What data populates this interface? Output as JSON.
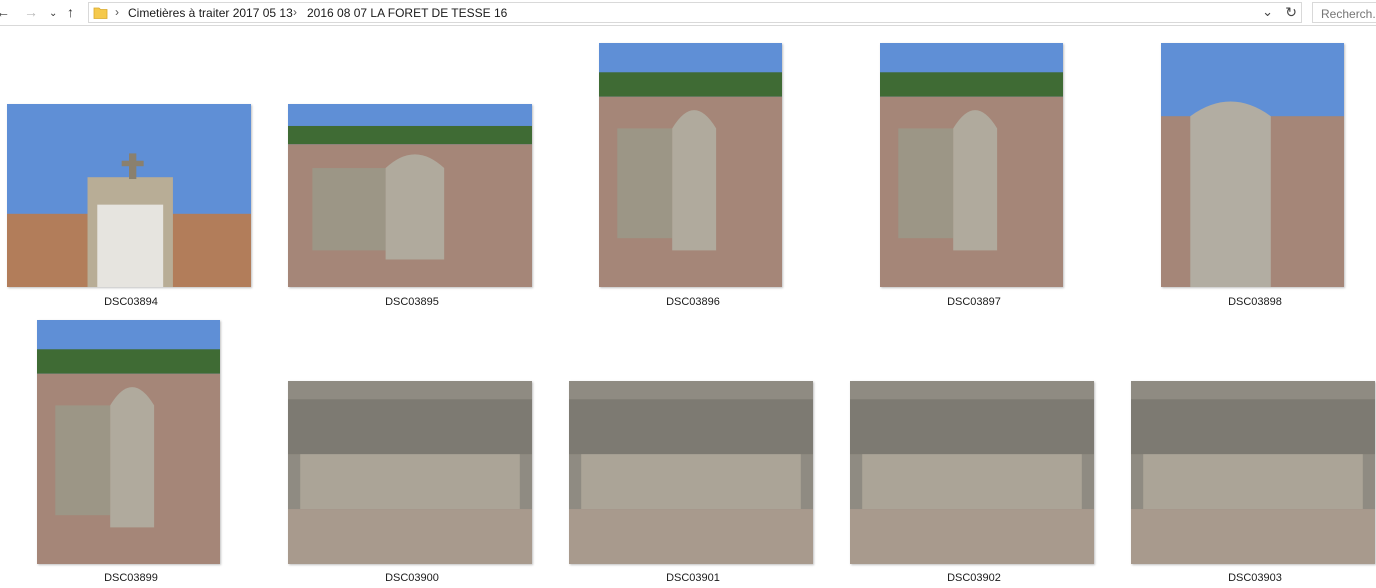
{
  "address": {
    "breadcrumbs": [
      "Cimetières à traiter 2017 05 13",
      "2016 08 07 LA FORET DE TESSE 16"
    ],
    "search_placeholder": "Recherch..."
  },
  "files": [
    {
      "name": "DSC03894",
      "kind": "gate"
    },
    {
      "name": "DSC03895",
      "kind": "graves-wide"
    },
    {
      "name": "DSC03896",
      "kind": "graves-tall"
    },
    {
      "name": "DSC03897",
      "kind": "graves-tall"
    },
    {
      "name": "DSC03898",
      "kind": "headstone"
    },
    {
      "name": "DSC03899",
      "kind": "graves-tall"
    },
    {
      "name": "DSC03900",
      "kind": "slab"
    },
    {
      "name": "DSC03901",
      "kind": "slab"
    },
    {
      "name": "DSC03902",
      "kind": "slab"
    },
    {
      "name": "DSC03903",
      "kind": "slab"
    }
  ],
  "colors": {
    "sky": "#5f8fd6",
    "stone": "#9c9686",
    "gravel": "#a58678",
    "folder": "#f5c94c"
  }
}
